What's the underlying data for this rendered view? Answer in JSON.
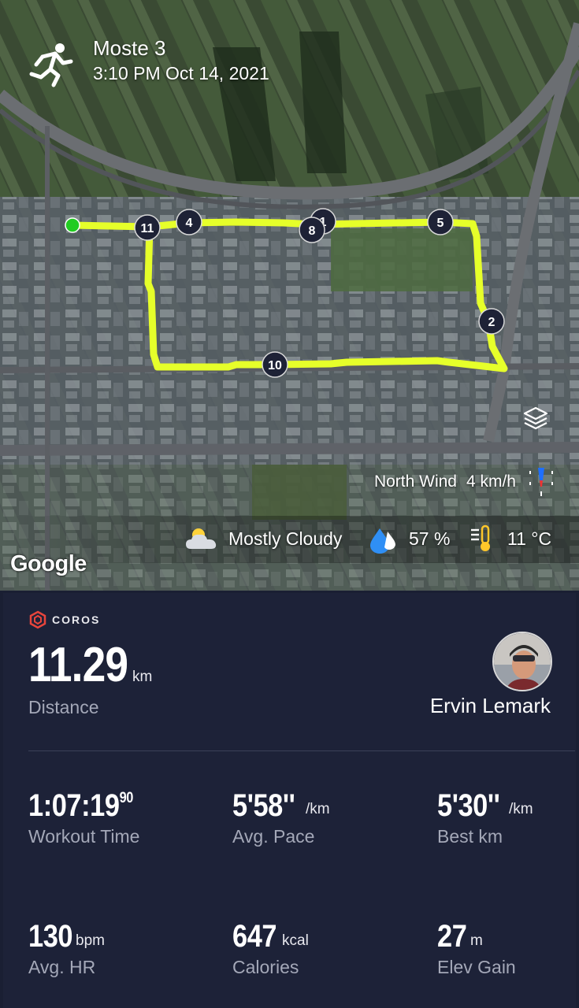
{
  "activity": {
    "title": "Moste 3",
    "datetime": "3:10 PM Oct 14, 2021",
    "icon": "runner-icon"
  },
  "map": {
    "provider_logo": "Google",
    "route_color": "#e6ff2a",
    "start_color": "#22cc22",
    "markers": [
      "11",
      "4",
      "1",
      "8",
      "5",
      "2",
      "10"
    ],
    "wind": {
      "label": "North Wind",
      "value": "4 km/h"
    },
    "weather": {
      "condition": "Mostly Cloudy",
      "humidity": "57 %",
      "temperature": "11 °C"
    }
  },
  "panel": {
    "brand": "COROS",
    "brand_color": "#e8453c",
    "user_name": "Ervin Lemark",
    "distance": {
      "value": "11.29",
      "unit": "km",
      "label": "Distance"
    },
    "stats": {
      "workout_time": {
        "value": "1:07:19",
        "fraction": "90",
        "label": "Workout Time"
      },
      "avg_pace": {
        "value": "5'58''",
        "unit": "/km",
        "label": "Avg. Pace"
      },
      "best_km": {
        "value": "5'30''",
        "unit": "/km",
        "label": "Best km"
      },
      "avg_hr": {
        "value": "130",
        "unit": "bpm",
        "label": "Avg. HR"
      },
      "calories": {
        "value": "647",
        "unit": "kcal",
        "label": "Calories"
      },
      "elev_gain": {
        "value": "27",
        "unit": "m",
        "label": "Elev Gain"
      }
    }
  }
}
